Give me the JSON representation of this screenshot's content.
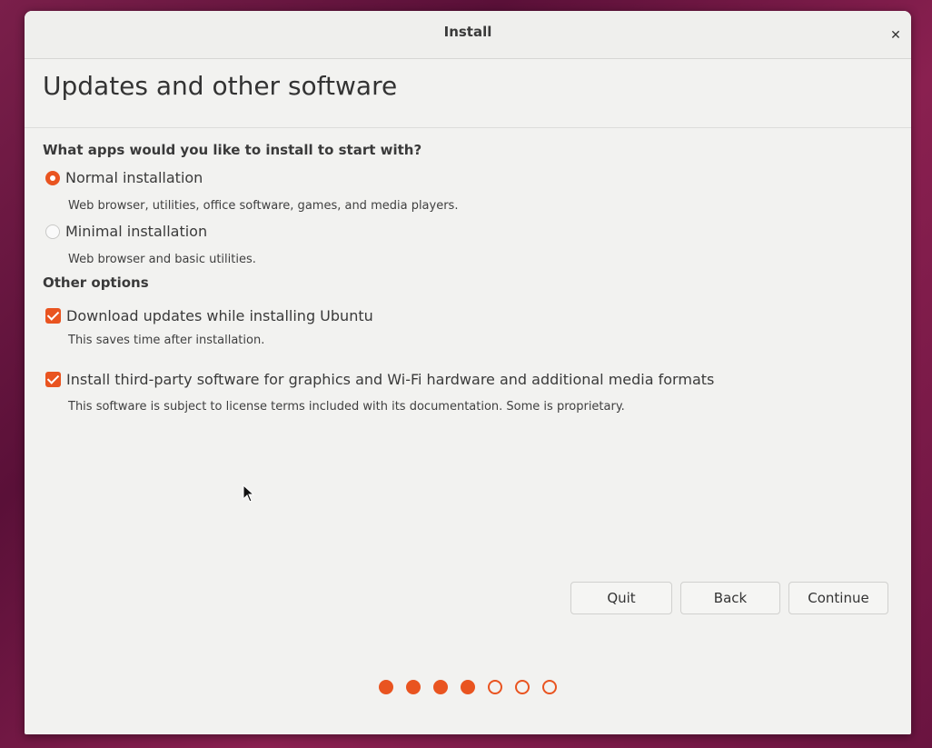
{
  "window": {
    "title": "Install",
    "close_icon": "close-icon"
  },
  "page": {
    "title": "Updates and other software"
  },
  "apps_section": {
    "heading": "What apps would you like to install to start with?",
    "options": [
      {
        "label": "Normal installation",
        "description": "Web browser, utilities, office software, games, and media players.",
        "selected": true
      },
      {
        "label": "Minimal installation",
        "description": "Web browser and basic utilities.",
        "selected": false
      }
    ]
  },
  "other_options": {
    "heading": "Other options",
    "items": [
      {
        "label": "Download updates while installing Ubuntu",
        "description": "This saves time after installation.",
        "checked": true
      },
      {
        "label": "Install third-party software for graphics and Wi-Fi hardware and additional media formats",
        "description": "This software is subject to license terms included with its documentation. Some is proprietary.",
        "checked": true
      }
    ]
  },
  "buttons": {
    "quit": "Quit",
    "back": "Back",
    "continue": "Continue"
  },
  "progress": {
    "current_step": 4,
    "total_steps": 7
  },
  "colors": {
    "accent": "#e95420",
    "window_bg": "#f2f2f0",
    "text": "#3a3a3a"
  }
}
